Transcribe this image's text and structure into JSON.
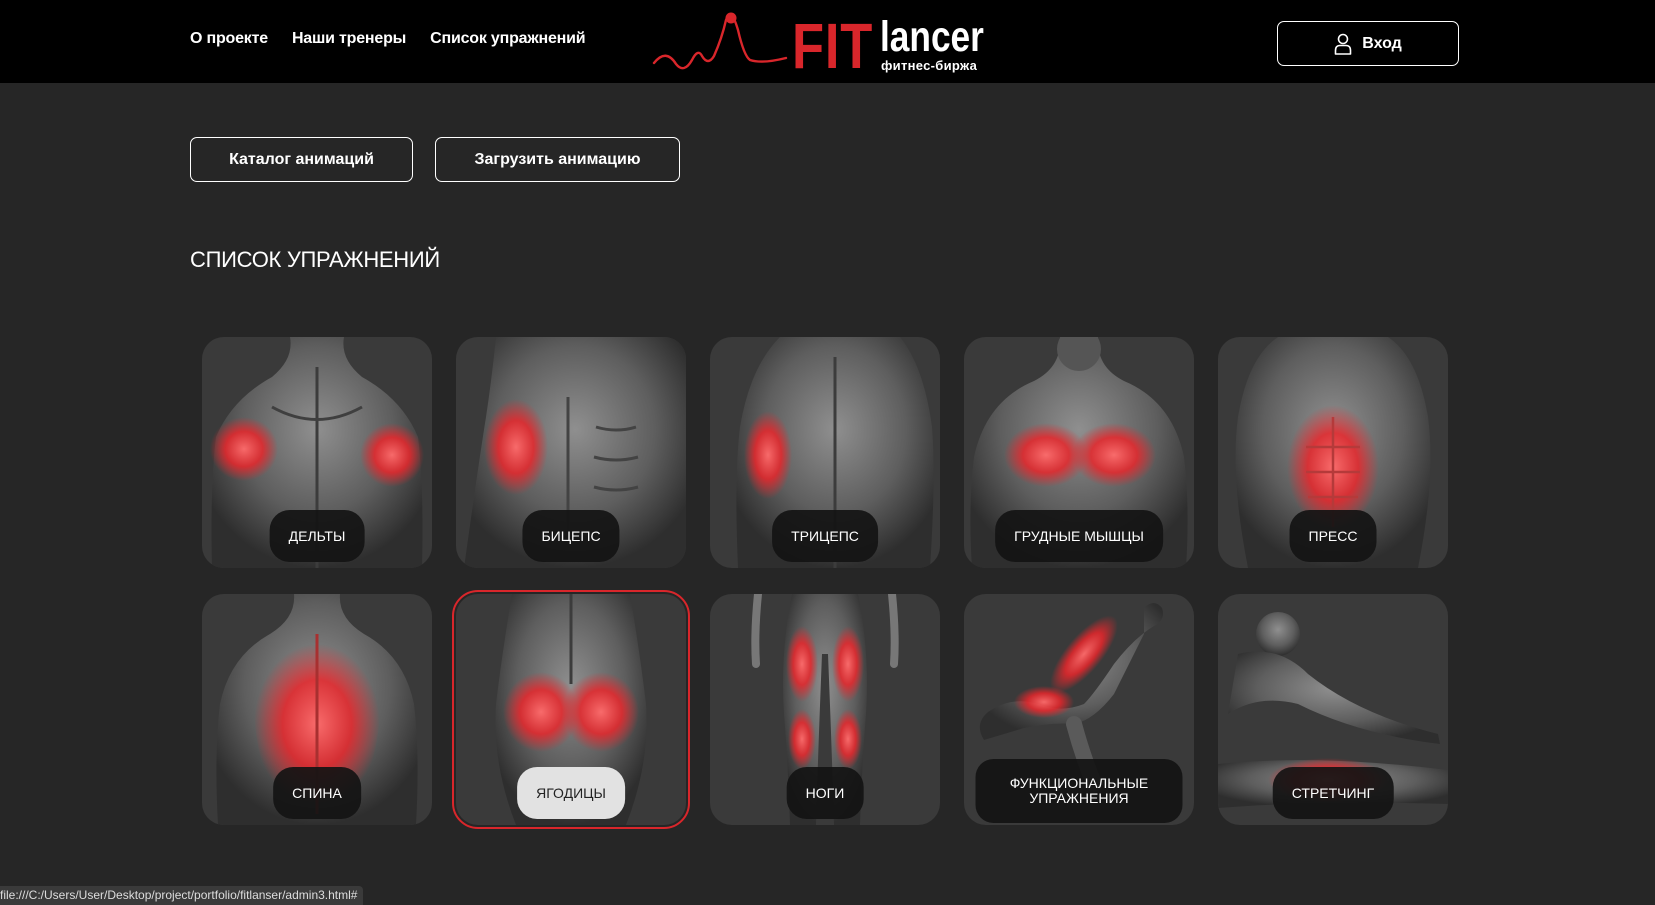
{
  "header": {
    "nav": [
      "О проекте",
      "Наши тренеры",
      "Список упражнений"
    ],
    "logo": {
      "fit": "FIT",
      "lancer": "lancer",
      "subtitle": "фитнес-биржа"
    },
    "login_label": "Вход"
  },
  "actions": {
    "catalog_label": "Каталог анимаций",
    "upload_label": "Загрузить анимацию"
  },
  "section_title": "СПИСОК УПРАЖНЕНИЙ",
  "exercises": [
    {
      "label": "ДЕЛЬТЫ",
      "icon": "back-deltoids-figure",
      "active": false
    },
    {
      "label": "БИЦЕПС",
      "icon": "torso-biceps-figure",
      "active": false
    },
    {
      "label": "ТРИЦЕПС",
      "icon": "back-triceps-figure",
      "active": false
    },
    {
      "label": "ГРУДНЫЕ МЫШЦЫ",
      "icon": "chest-figure",
      "active": false
    },
    {
      "label": "ПРЕСС",
      "icon": "abs-figure",
      "active": false
    },
    {
      "label": "СПИНА",
      "icon": "back-figure",
      "active": false
    },
    {
      "label": "ЯГОДИЦЫ",
      "icon": "glutes-figure",
      "active": true
    },
    {
      "label": "НОГИ",
      "icon": "legs-figure",
      "active": false
    },
    {
      "label": "ФУНКЦИОНАЛЬНЫЕ УПРАЖНЕНИЯ",
      "icon": "lunge-figure",
      "active": false
    },
    {
      "label": "СТРЕТЧИНГ",
      "icon": "stretch-figure",
      "active": false
    }
  ],
  "status_url": "file:///C:/Users/User/Desktop/project/portfolio/fitlanser/admin3.html#",
  "colors": {
    "accent": "#d9262b",
    "background": "#262626",
    "header": "#000000",
    "card": "#3a3a3a"
  }
}
